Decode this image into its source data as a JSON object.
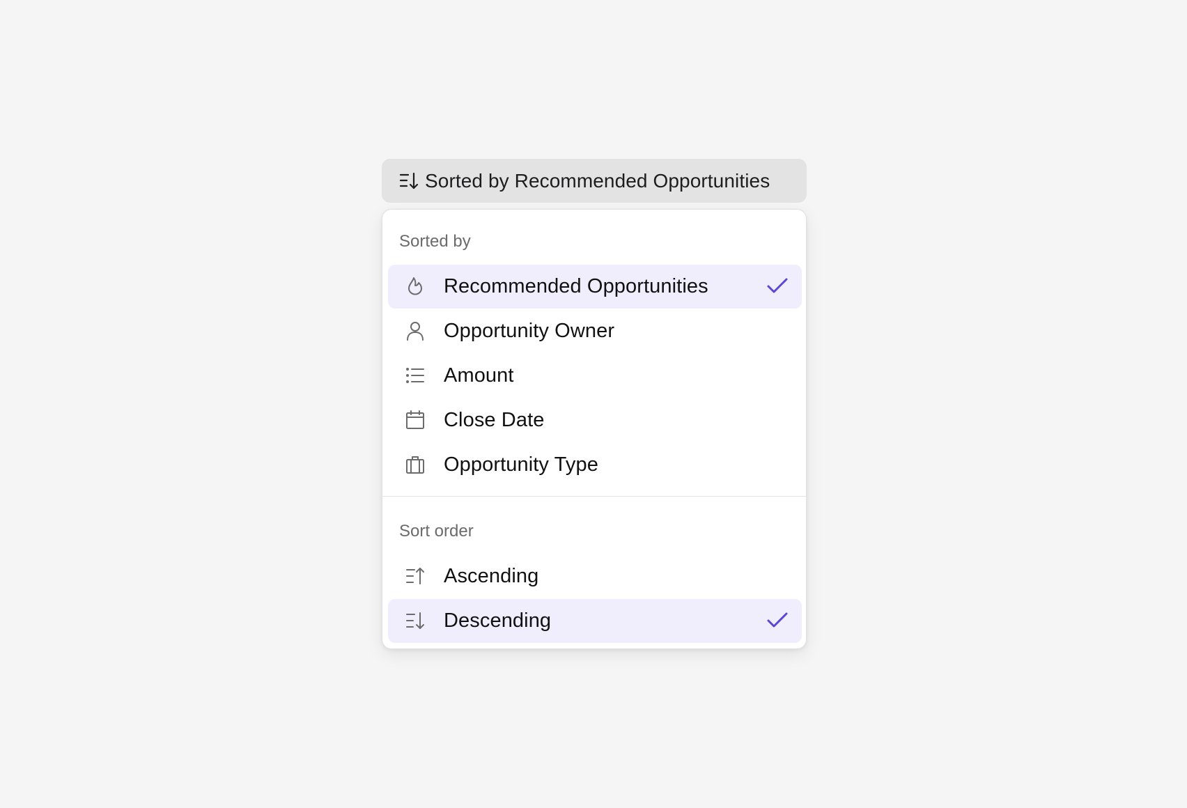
{
  "trigger": {
    "icon": "sort-descending-icon",
    "label": "Sorted by Recommended Opportunities"
  },
  "menu": {
    "sort_by_section": {
      "title": "Sorted by",
      "items": [
        {
          "label": "Recommended Opportunities",
          "icon": "flame-icon",
          "selected": true
        },
        {
          "label": "Opportunity Owner",
          "icon": "user-icon",
          "selected": false
        },
        {
          "label": "Amount",
          "icon": "list-icon",
          "selected": false
        },
        {
          "label": "Close Date",
          "icon": "calendar-icon",
          "selected": false
        },
        {
          "label": "Opportunity Type",
          "icon": "briefcase-icon",
          "selected": false
        }
      ]
    },
    "sort_order_section": {
      "title": "Sort order",
      "items": [
        {
          "label": "Ascending",
          "icon": "sort-ascending-icon",
          "selected": false
        },
        {
          "label": "Descending",
          "icon": "sort-descending-icon",
          "selected": true
        }
      ]
    }
  },
  "colors": {
    "selected_background": "#f0eefd",
    "accent_check": "#5b47d6",
    "trigger_background": "#e3e3e3",
    "page_background": "#f5f5f5"
  }
}
